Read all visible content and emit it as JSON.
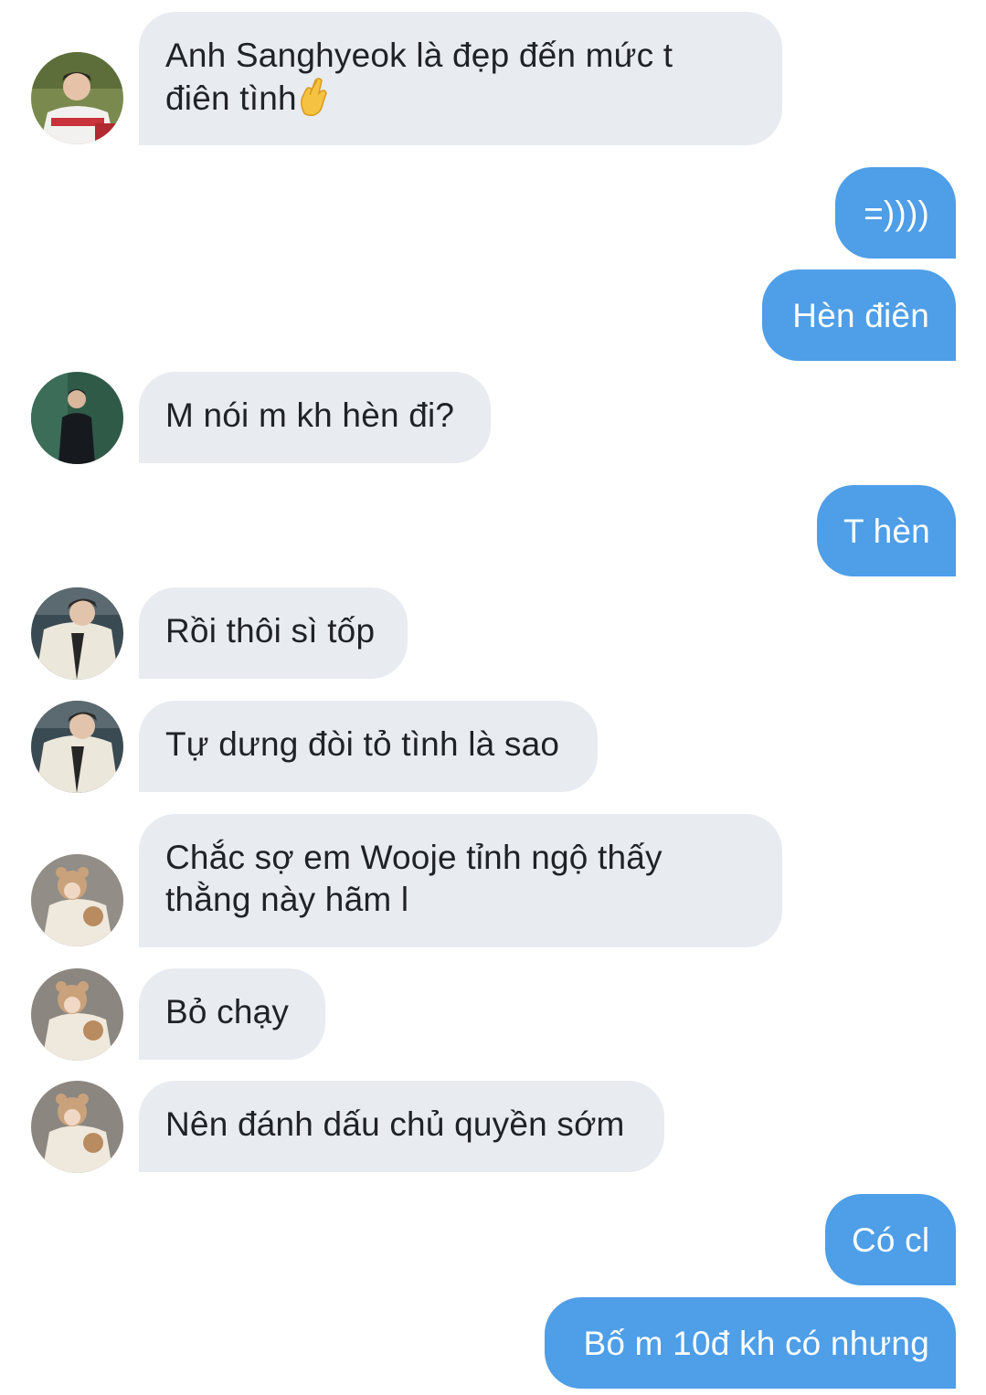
{
  "messages": [
    {
      "direction": "in",
      "avatar": "avatar-baseball-jersey",
      "lines": [
        "Anh Sanghyeok là đẹp đến mức t",
        "điên tình"
      ],
      "emoji": "fingers-crossed-icon"
    },
    {
      "direction": "out",
      "lines": [
        "=))))"
      ]
    },
    {
      "direction": "out",
      "lines": [
        "Hèn điên"
      ]
    },
    {
      "direction": "in",
      "avatar": "avatar-dark-suit",
      "lines": [
        "M nói m kh hèn đi?"
      ]
    },
    {
      "direction": "out",
      "lines": [
        "T hèn"
      ]
    },
    {
      "direction": "in",
      "avatar": "avatar-white-jacket",
      "lines": [
        "Rồi thôi sì tốp"
      ]
    },
    {
      "direction": "in",
      "avatar": "avatar-white-jacket",
      "lines": [
        "Tự dưng đòi tỏ tình là sao"
      ]
    },
    {
      "direction": "in",
      "avatar": "avatar-bear-hat",
      "lines": [
        "Chắc sợ em Wooje tỉnh ngộ thấy",
        "thằng này hãm l"
      ]
    },
    {
      "direction": "in",
      "avatar": "avatar-bear-hat",
      "lines": [
        "Bỏ chạy"
      ]
    },
    {
      "direction": "in",
      "avatar": "avatar-bear-hat",
      "lines": [
        "Nên đánh dấu chủ quyền sớm"
      ]
    },
    {
      "direction": "out",
      "lines": [
        "Có cl"
      ]
    },
    {
      "direction": "out",
      "lines": [
        "Bố m 10đ kh có nhưng"
      ]
    }
  ],
  "colors": {
    "incoming_bubble": "#e8ebef",
    "incoming_text": "#1f2226",
    "outgoing_bubble": "#4e9ee8",
    "outgoing_text": "#ffffff"
  }
}
